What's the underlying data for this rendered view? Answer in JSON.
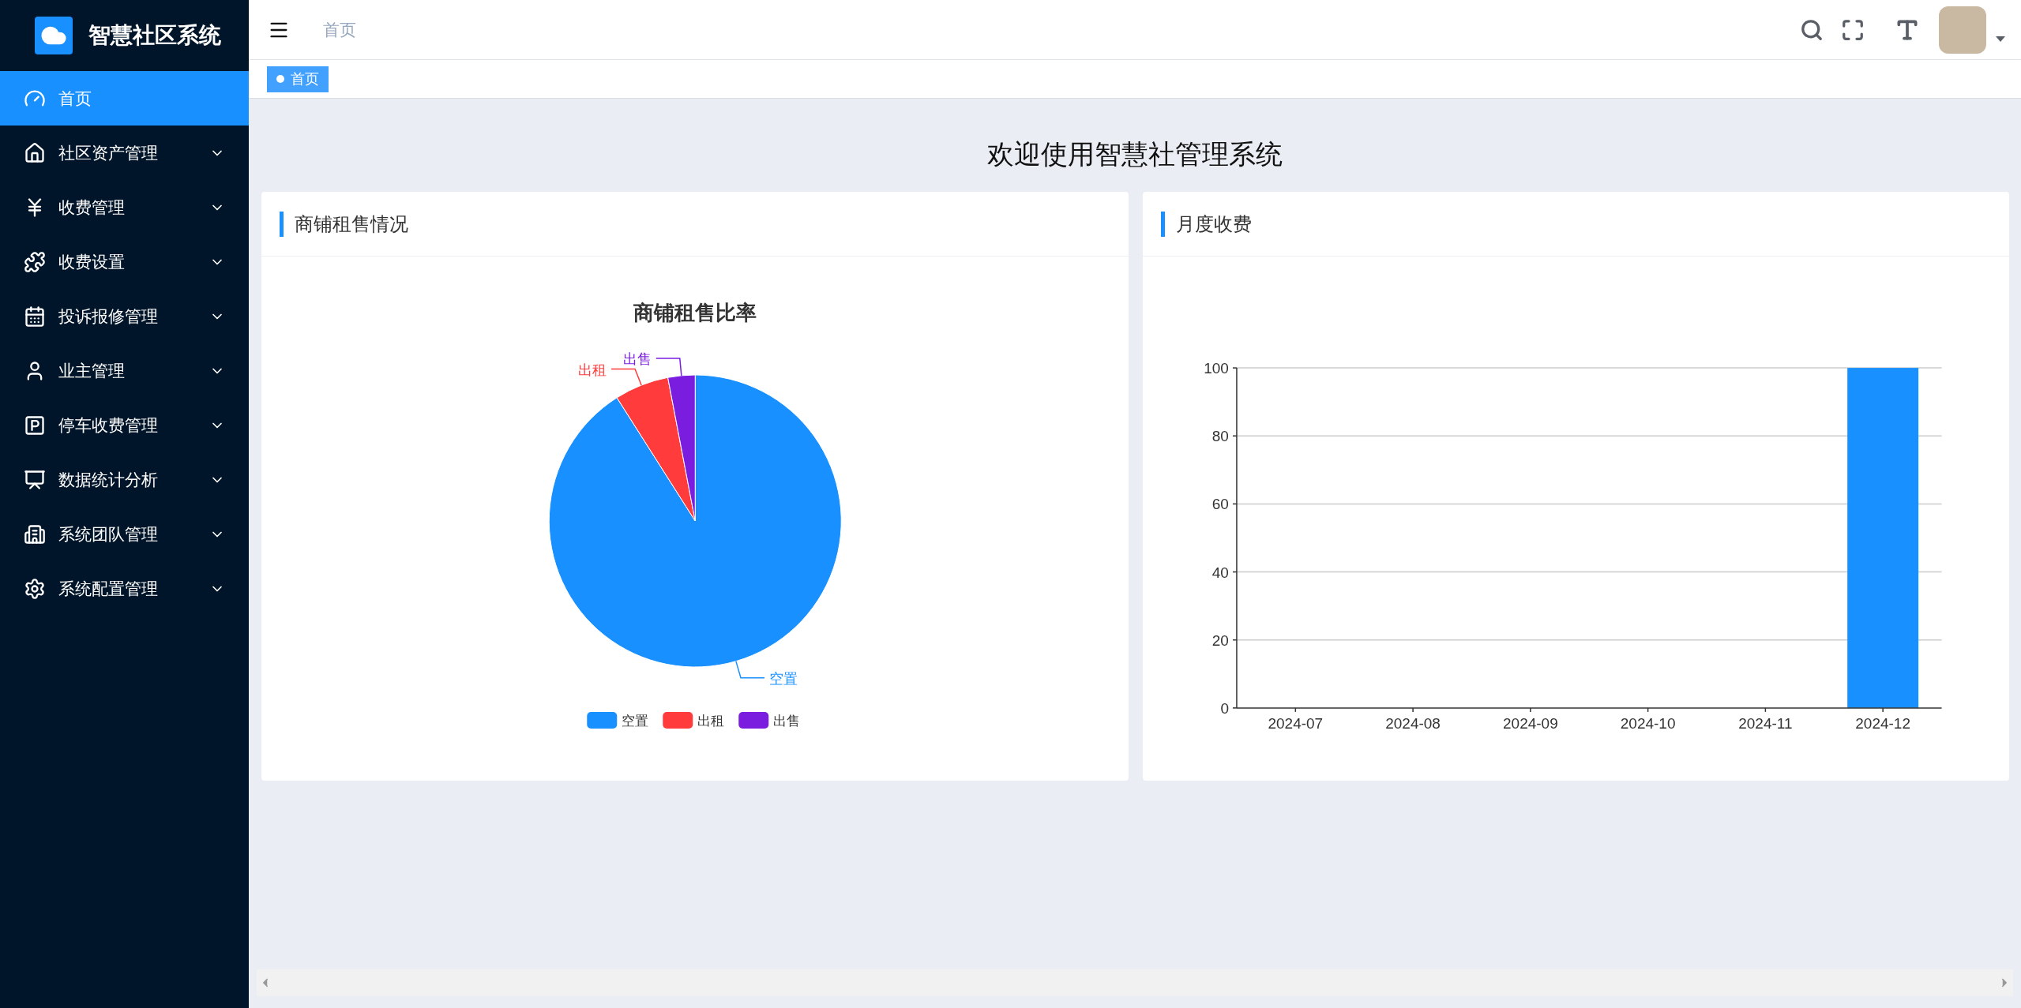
{
  "app": {
    "name": "智慧社区系统"
  },
  "sidebar": {
    "items": [
      {
        "label": "首页",
        "selected": true
      },
      {
        "label": "社区资产管理",
        "selected": false,
        "expanded": false
      },
      {
        "label": "收费管理",
        "selected": false,
        "expanded": false
      },
      {
        "label": "收费设置",
        "selected": false,
        "expanded": false
      },
      {
        "label": "投诉报修管理",
        "selected": false,
        "expanded": false
      },
      {
        "label": "业主管理",
        "selected": false,
        "expanded": false
      },
      {
        "label": "停车收费管理",
        "selected": false,
        "expanded": false
      },
      {
        "label": "数据统计分析",
        "selected": false,
        "expanded": false
      },
      {
        "label": "系统团队管理",
        "selected": false,
        "expanded": false
      },
      {
        "label": "系统配置管理",
        "selected": false,
        "expanded": false
      }
    ]
  },
  "header": {
    "breadcrumb": "首页"
  },
  "tags": [
    {
      "label": "首页",
      "selected": true
    }
  ],
  "page": {
    "title": "欢迎使用智慧社管理系统"
  },
  "cards": [
    {
      "title": "商铺租售情况",
      "chart_data": {
        "type": "pie",
        "title": "商铺租售比率",
        "categories": [
          "空置",
          "出租",
          "出售"
        ],
        "colors": [
          "#1890ff",
          "#ff3b3b",
          "#7b1ddf"
        ],
        "legend": "bottom",
        "series": [
          {
            "values": [
              91,
              6,
              3
            ]
          }
        ]
      }
    },
    {
      "title": "月度收费",
      "chart_data": {
        "type": "bar",
        "categories": [
          "2024-07",
          "2024-08",
          "2024-09",
          "2024-10",
          "2024-11",
          "2024-12"
        ],
        "ylim": [
          0,
          100
        ],
        "grid": true,
        "yticks": [
          0,
          20,
          40,
          60,
          80,
          100
        ],
        "series": [
          {
            "color": "#1890ff",
            "values": [
              0,
              0,
              0,
              0,
              0,
              100
            ]
          }
        ]
      }
    }
  ]
}
